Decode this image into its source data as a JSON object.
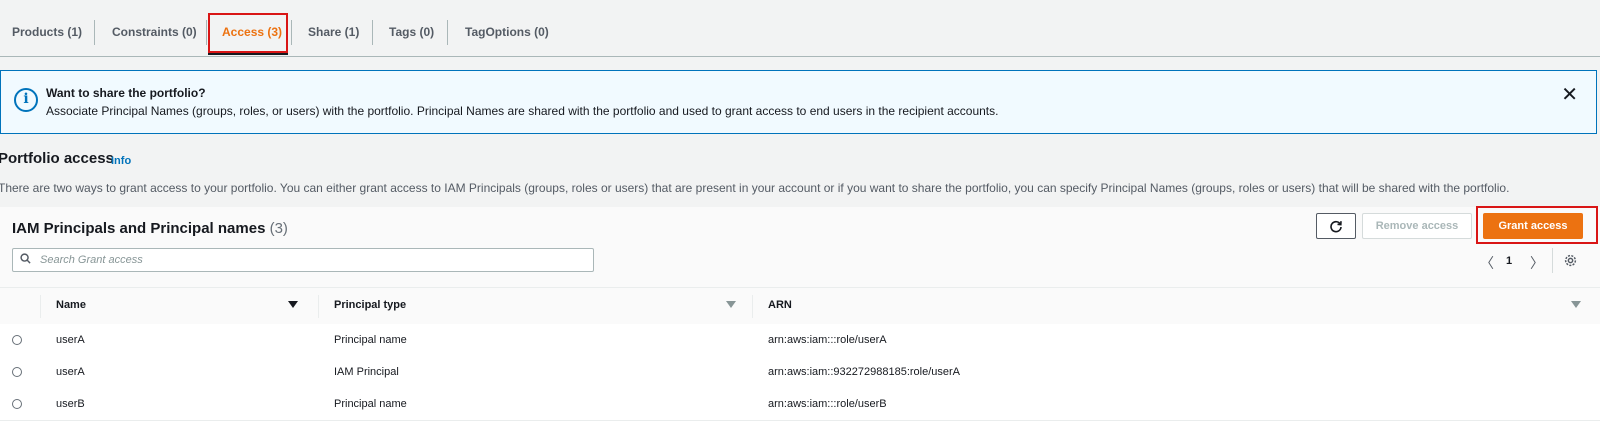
{
  "tabs": [
    {
      "label": "Products (1)"
    },
    {
      "label": "Constraints (0)"
    },
    {
      "label": "Access (3)"
    },
    {
      "label": "Share (1)"
    },
    {
      "label": "Tags (0)"
    },
    {
      "label": "TagOptions (0)"
    }
  ],
  "active_tab": "Access (3)",
  "flash": {
    "title": "Want to share the portfolio?",
    "text": "Associate Principal Names (groups, roles, or users) with the portfolio. Principal Names are shared with the portfolio and used to grant access to end users in the recipient accounts."
  },
  "section": {
    "title": "Portfolio access",
    "info": "Info",
    "description": "There are two ways to grant access to your portfolio. You can either grant access to IAM Principals (groups, roles or users) that are present in your account or if you want to share the portfolio, you can specify Principal Names (groups, roles or users) that will be shared with the portfolio."
  },
  "panel": {
    "title": "IAM Principals and Principal names",
    "count": "(3)",
    "search_placeholder": "Search Grant access",
    "remove_label": "Remove access",
    "grant_label": "Grant access",
    "page": "1"
  },
  "columns": [
    "Name",
    "Principal type",
    "ARN"
  ],
  "rows": [
    {
      "name": "userA",
      "type": "Principal name",
      "arn": "arn:aws:iam:::role/userA"
    },
    {
      "name": "userA",
      "type": "IAM Principal",
      "arn": "arn:aws:iam::932272988185:role/userA"
    },
    {
      "name": "userB",
      "type": "Principal name",
      "arn": "arn:aws:iam:::role/userB"
    }
  ],
  "colors": {
    "accent": "#ec7211",
    "highlight": "#d91515",
    "info_blue": "#0073bb"
  },
  "icons": [
    "info-icon",
    "close-icon",
    "search-icon",
    "refresh-icon",
    "chevron-left-icon",
    "chevron-right-icon",
    "settings-icon",
    "sort-down-icon",
    "radio-icon"
  ]
}
